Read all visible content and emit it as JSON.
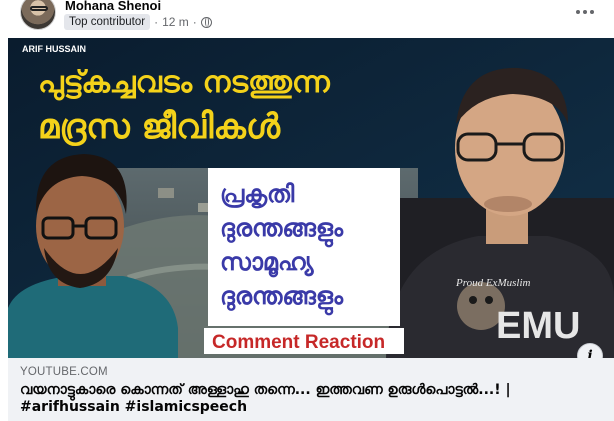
{
  "post": {
    "author": "Mohana Shenoi",
    "badge": "Top contributor",
    "time": "12 m",
    "separator": "·",
    "audience_icon": "globe-icon",
    "more_icon": "more-horizontal-icon"
  },
  "thumbnail": {
    "channel_logo": "ARIF HUSSAIN",
    "headline_line1": "പുട്ട്കച്ചവടം നടത്തുന്ന",
    "headline_line2": "മദ്രസ ജീവികൾ",
    "box_line1": "പ്രകൃതി",
    "box_line2": "ദുരന്തങ്ങളും",
    "box_line3": "സാമൂഹ്യ",
    "box_line4": "ദുരന്തങ്ങളും",
    "banner": "Comment Reaction",
    "shirt_line1": "Proud ExMuslim",
    "shirt_line2": "EMU",
    "colors": {
      "headline": "#f4d21a",
      "box_text": "#3a3aa8",
      "banner_bg": "#ffffff",
      "banner_text": "#c62828"
    }
  },
  "link_preview": {
    "domain": "YOUTUBE.COM",
    "title": "വയനാട്ടുകാരെ കൊന്നത് അള്ളാഹു തന്നെ... ഇത്തവണ ഉരുൾപൊട്ടൽ...! | #arifhussain #islamicspeech",
    "info_icon": "info-icon"
  }
}
